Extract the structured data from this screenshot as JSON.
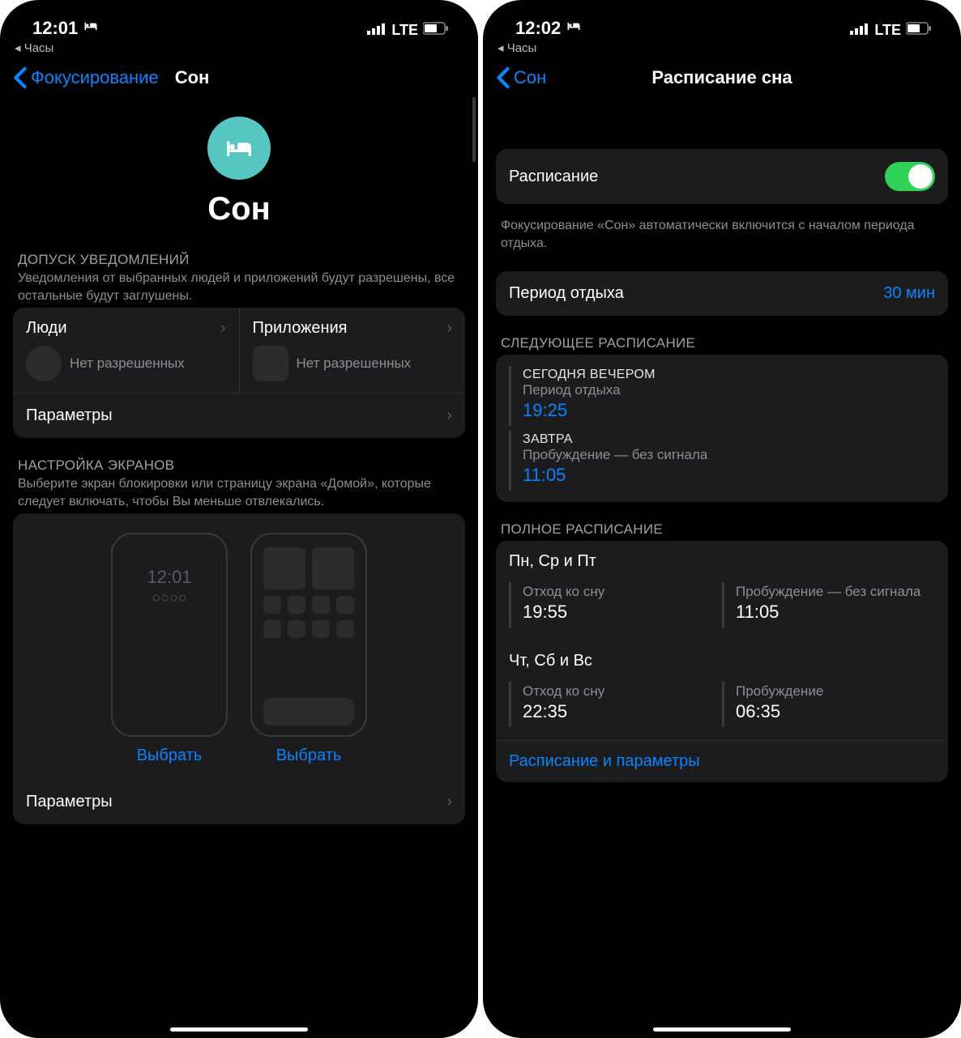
{
  "left": {
    "status": {
      "time": "12:01",
      "breadcrumb": "Часы",
      "network": "LTE"
    },
    "nav": {
      "back": "Фокусирование",
      "title": "Сон"
    },
    "hero": {
      "title": "Сон",
      "icon": "bed-icon"
    },
    "notifications": {
      "header": "ДОПУСК УВЕДОМЛЕНИЙ",
      "subtitle": "Уведомления от выбранных людей и приложений будут разрешены, все остальные будут заглушены.",
      "people": {
        "title": "Люди",
        "empty": "Нет разрешенных"
      },
      "apps": {
        "title": "Приложения",
        "empty": "Нет разрешенных"
      },
      "options": "Параметры"
    },
    "screens": {
      "header": "НАСТРОЙКА ЭКРАНОВ",
      "subtitle": "Выберите экран блокировки или страницу экрана «Домой», которые следует включать, чтобы Вы меньше отвлекались.",
      "lock_time": "12:01",
      "choose": "Выбрать",
      "options": "Параметры"
    }
  },
  "right": {
    "status": {
      "time": "12:02",
      "breadcrumb": "Часы",
      "network": "LTE"
    },
    "nav": {
      "back": "Сон",
      "title": "Расписание сна"
    },
    "schedule_toggle": {
      "label": "Расписание",
      "on": true
    },
    "schedule_footer": "Фокусирование «Сон» автоматически включится с началом периода отдыха.",
    "wind_down": {
      "label": "Период отдыха",
      "value": "30 мин"
    },
    "next": {
      "header": "СЛЕДУЮЩЕЕ РАСПИСАНИЕ",
      "items": [
        {
          "caption": "СЕГОДНЯ ВЕЧЕРОМ",
          "sub": "Период отдыха",
          "time": "19:25"
        },
        {
          "caption": "ЗАВТРА",
          "sub": "Пробуждение — без сигнала",
          "time": "11:05"
        }
      ]
    },
    "full": {
      "header": "ПОЛНОЕ РАСПИСАНИЕ",
      "groups": [
        {
          "days": "Пн, Ср и Пт",
          "bed": {
            "label": "Отход ко сну",
            "time": "19:55"
          },
          "wake": {
            "label": "Пробуждение — без сигнала",
            "time": "11:05"
          }
        },
        {
          "days": "Чт, Сб и Вс",
          "bed": {
            "label": "Отход ко сну",
            "time": "22:35"
          },
          "wake": {
            "label": "Пробуждение",
            "time": "06:35"
          }
        }
      ],
      "link": "Расписание и параметры"
    }
  }
}
